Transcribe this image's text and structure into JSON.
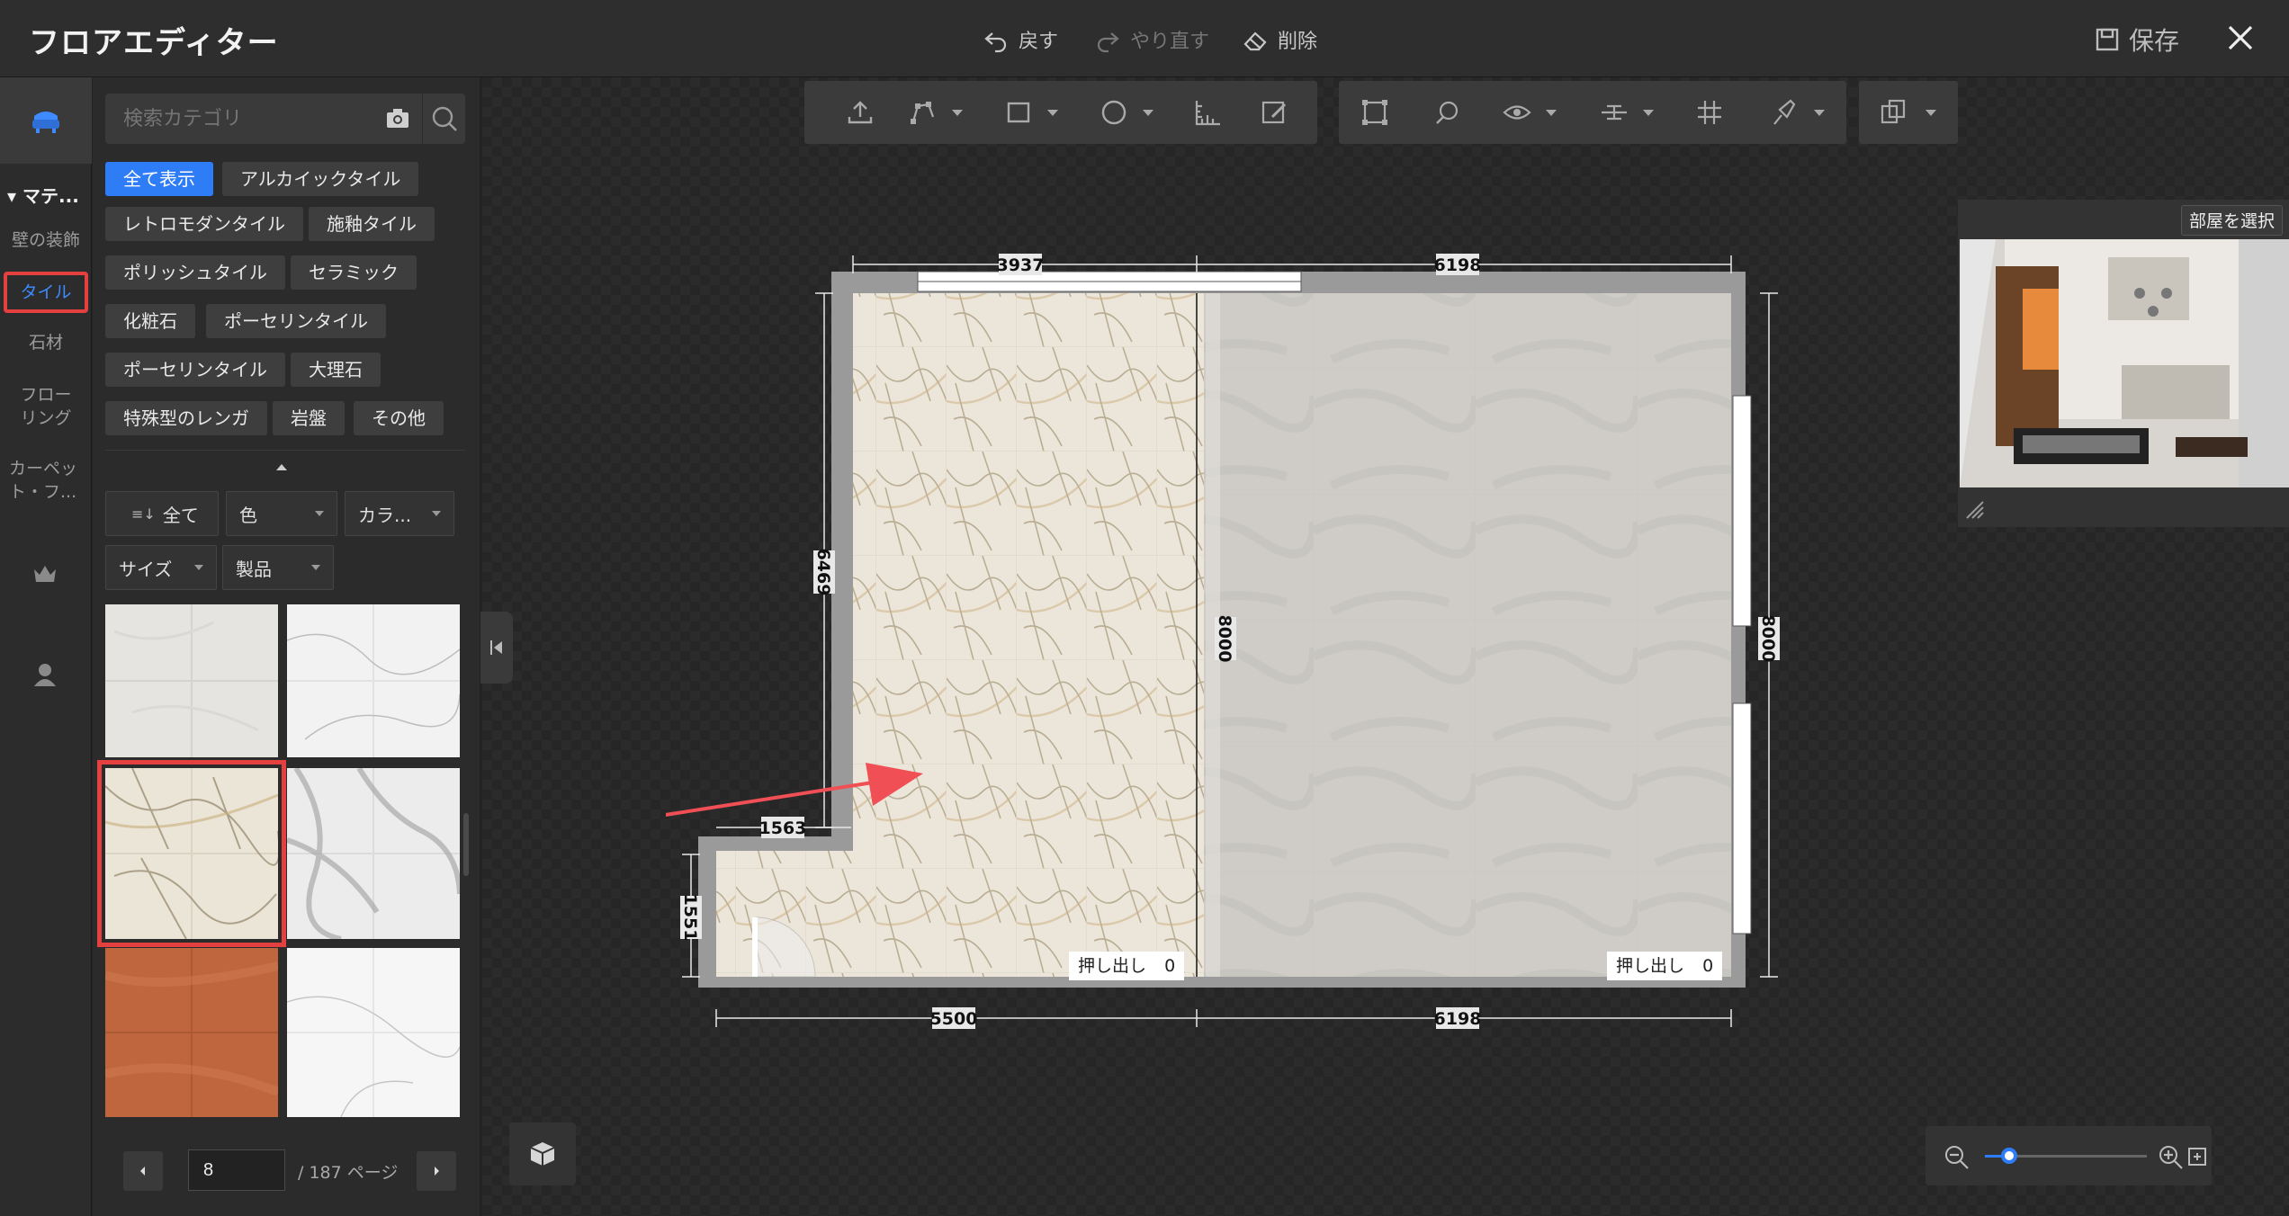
{
  "titlebar": {
    "title": "フロアエディター",
    "undo_label": "戻す",
    "redo_label": "やり直す",
    "delete_label": "削除",
    "save_label": "保存"
  },
  "rail": {
    "category_header": "マテ...",
    "items": [
      {
        "label": "壁の装飾"
      },
      {
        "label": "タイル"
      },
      {
        "label": "石材"
      },
      {
        "label": "フローリング"
      },
      {
        "label": "カーペット・フ..."
      }
    ],
    "active_item": "タイル",
    "icons": [
      "furniture-icon",
      "crown-icon",
      "user-icon"
    ]
  },
  "panel": {
    "search": {
      "placeholder": "検索カテゴリ"
    },
    "chips": [
      "全て表示",
      "アルカイックタイル",
      "レトロモダンタイル",
      "施釉タイル",
      "ポリッシュタイル",
      "セラミック",
      "化粧石",
      "ポーセリンタイル",
      "ポーセリンタイル",
      "大理石",
      "特殊型のレンガ",
      "岩盤",
      "その他"
    ],
    "active_chip": "全て表示",
    "filters": {
      "sort": "全て",
      "color": "色",
      "collection": "カラ...",
      "size": "サイズ",
      "product": "製品"
    },
    "thumbnails": [
      "light-grey-tile",
      "white-marble-tile",
      "calacatta-gold-marble-tile",
      "grey-veined-marble-tile",
      "terracotta-tile",
      "white-marble-tile"
    ],
    "selected_thumbnail": "calacatta-gold-marble-tile",
    "pager": {
      "current": "8",
      "total_label": "/ 187 ページ"
    }
  },
  "canvas": {
    "preview_button": "部屋を選択",
    "zoom_percent": 15,
    "plan": {
      "dims": {
        "top_left": "3937",
        "top_right": "6198",
        "left_upper": "6469",
        "left_lower": "1551",
        "inner_divider": "8000",
        "right": "8000",
        "bottom_left": "5500",
        "bottom_right": "6198",
        "notch": "1563"
      },
      "extrude_label": "押し出し",
      "extrude_value": "0"
    }
  },
  "colors": {
    "accent": "#2f7df6",
    "highlight": "#e54040",
    "arrow": "#ef4f55"
  }
}
